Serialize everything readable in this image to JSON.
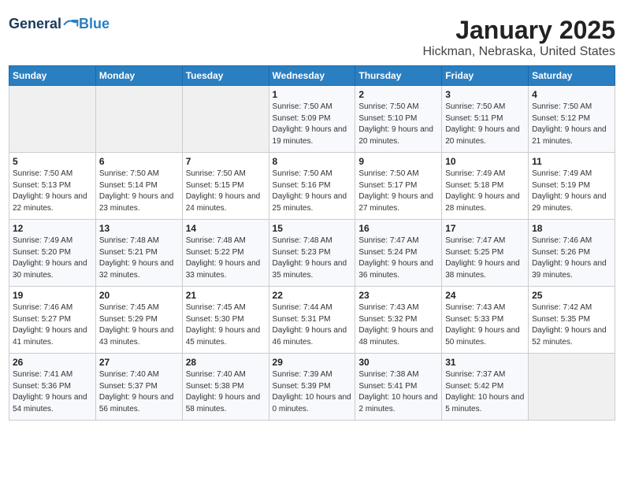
{
  "header": {
    "logo_general": "General",
    "logo_blue": "Blue",
    "month": "January 2025",
    "location": "Hickman, Nebraska, United States"
  },
  "weekdays": [
    "Sunday",
    "Monday",
    "Tuesday",
    "Wednesday",
    "Thursday",
    "Friday",
    "Saturday"
  ],
  "weeks": [
    [
      {
        "day": "",
        "sunrise": "",
        "sunset": "",
        "daylight": "",
        "empty": true
      },
      {
        "day": "",
        "sunrise": "",
        "sunset": "",
        "daylight": "",
        "empty": true
      },
      {
        "day": "",
        "sunrise": "",
        "sunset": "",
        "daylight": "",
        "empty": true
      },
      {
        "day": "1",
        "sunrise": "Sunrise: 7:50 AM",
        "sunset": "Sunset: 5:09 PM",
        "daylight": "Daylight: 9 hours and 19 minutes."
      },
      {
        "day": "2",
        "sunrise": "Sunrise: 7:50 AM",
        "sunset": "Sunset: 5:10 PM",
        "daylight": "Daylight: 9 hours and 20 minutes."
      },
      {
        "day": "3",
        "sunrise": "Sunrise: 7:50 AM",
        "sunset": "Sunset: 5:11 PM",
        "daylight": "Daylight: 9 hours and 20 minutes."
      },
      {
        "day": "4",
        "sunrise": "Sunrise: 7:50 AM",
        "sunset": "Sunset: 5:12 PM",
        "daylight": "Daylight: 9 hours and 21 minutes."
      }
    ],
    [
      {
        "day": "5",
        "sunrise": "Sunrise: 7:50 AM",
        "sunset": "Sunset: 5:13 PM",
        "daylight": "Daylight: 9 hours and 22 minutes."
      },
      {
        "day": "6",
        "sunrise": "Sunrise: 7:50 AM",
        "sunset": "Sunset: 5:14 PM",
        "daylight": "Daylight: 9 hours and 23 minutes."
      },
      {
        "day": "7",
        "sunrise": "Sunrise: 7:50 AM",
        "sunset": "Sunset: 5:15 PM",
        "daylight": "Daylight: 9 hours and 24 minutes."
      },
      {
        "day": "8",
        "sunrise": "Sunrise: 7:50 AM",
        "sunset": "Sunset: 5:16 PM",
        "daylight": "Daylight: 9 hours and 25 minutes."
      },
      {
        "day": "9",
        "sunrise": "Sunrise: 7:50 AM",
        "sunset": "Sunset: 5:17 PM",
        "daylight": "Daylight: 9 hours and 27 minutes."
      },
      {
        "day": "10",
        "sunrise": "Sunrise: 7:49 AM",
        "sunset": "Sunset: 5:18 PM",
        "daylight": "Daylight: 9 hours and 28 minutes."
      },
      {
        "day": "11",
        "sunrise": "Sunrise: 7:49 AM",
        "sunset": "Sunset: 5:19 PM",
        "daylight": "Daylight: 9 hours and 29 minutes."
      }
    ],
    [
      {
        "day": "12",
        "sunrise": "Sunrise: 7:49 AM",
        "sunset": "Sunset: 5:20 PM",
        "daylight": "Daylight: 9 hours and 30 minutes."
      },
      {
        "day": "13",
        "sunrise": "Sunrise: 7:48 AM",
        "sunset": "Sunset: 5:21 PM",
        "daylight": "Daylight: 9 hours and 32 minutes."
      },
      {
        "day": "14",
        "sunrise": "Sunrise: 7:48 AM",
        "sunset": "Sunset: 5:22 PM",
        "daylight": "Daylight: 9 hours and 33 minutes."
      },
      {
        "day": "15",
        "sunrise": "Sunrise: 7:48 AM",
        "sunset": "Sunset: 5:23 PM",
        "daylight": "Daylight: 9 hours and 35 minutes."
      },
      {
        "day": "16",
        "sunrise": "Sunrise: 7:47 AM",
        "sunset": "Sunset: 5:24 PM",
        "daylight": "Daylight: 9 hours and 36 minutes."
      },
      {
        "day": "17",
        "sunrise": "Sunrise: 7:47 AM",
        "sunset": "Sunset: 5:25 PM",
        "daylight": "Daylight: 9 hours and 38 minutes."
      },
      {
        "day": "18",
        "sunrise": "Sunrise: 7:46 AM",
        "sunset": "Sunset: 5:26 PM",
        "daylight": "Daylight: 9 hours and 39 minutes."
      }
    ],
    [
      {
        "day": "19",
        "sunrise": "Sunrise: 7:46 AM",
        "sunset": "Sunset: 5:27 PM",
        "daylight": "Daylight: 9 hours and 41 minutes."
      },
      {
        "day": "20",
        "sunrise": "Sunrise: 7:45 AM",
        "sunset": "Sunset: 5:29 PM",
        "daylight": "Daylight: 9 hours and 43 minutes."
      },
      {
        "day": "21",
        "sunrise": "Sunrise: 7:45 AM",
        "sunset": "Sunset: 5:30 PM",
        "daylight": "Daylight: 9 hours and 45 minutes."
      },
      {
        "day": "22",
        "sunrise": "Sunrise: 7:44 AM",
        "sunset": "Sunset: 5:31 PM",
        "daylight": "Daylight: 9 hours and 46 minutes."
      },
      {
        "day": "23",
        "sunrise": "Sunrise: 7:43 AM",
        "sunset": "Sunset: 5:32 PM",
        "daylight": "Daylight: 9 hours and 48 minutes."
      },
      {
        "day": "24",
        "sunrise": "Sunrise: 7:43 AM",
        "sunset": "Sunset: 5:33 PM",
        "daylight": "Daylight: 9 hours and 50 minutes."
      },
      {
        "day": "25",
        "sunrise": "Sunrise: 7:42 AM",
        "sunset": "Sunset: 5:35 PM",
        "daylight": "Daylight: 9 hours and 52 minutes."
      }
    ],
    [
      {
        "day": "26",
        "sunrise": "Sunrise: 7:41 AM",
        "sunset": "Sunset: 5:36 PM",
        "daylight": "Daylight: 9 hours and 54 minutes."
      },
      {
        "day": "27",
        "sunrise": "Sunrise: 7:40 AM",
        "sunset": "Sunset: 5:37 PM",
        "daylight": "Daylight: 9 hours and 56 minutes."
      },
      {
        "day": "28",
        "sunrise": "Sunrise: 7:40 AM",
        "sunset": "Sunset: 5:38 PM",
        "daylight": "Daylight: 9 hours and 58 minutes."
      },
      {
        "day": "29",
        "sunrise": "Sunrise: 7:39 AM",
        "sunset": "Sunset: 5:39 PM",
        "daylight": "Daylight: 10 hours and 0 minutes."
      },
      {
        "day": "30",
        "sunrise": "Sunrise: 7:38 AM",
        "sunset": "Sunset: 5:41 PM",
        "daylight": "Daylight: 10 hours and 2 minutes."
      },
      {
        "day": "31",
        "sunrise": "Sunrise: 7:37 AM",
        "sunset": "Sunset: 5:42 PM",
        "daylight": "Daylight: 10 hours and 5 minutes."
      },
      {
        "day": "",
        "sunrise": "",
        "sunset": "",
        "daylight": "",
        "empty": true
      }
    ]
  ]
}
